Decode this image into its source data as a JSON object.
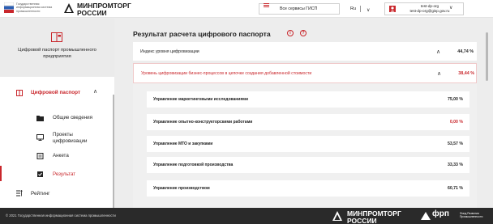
{
  "header": {
    "gisp_caption": "Государственная информационная система промышленности",
    "ministry_line1": "МИНПРОМТОРГ",
    "ministry_line2": "РОССИИ",
    "services_button": "Все сервисы ГИСП",
    "language": "Ru",
    "user_line1": "test-dp-org",
    "user_line2": "test-dp-org@gisp.gov.ru"
  },
  "sidebar": {
    "hero_title": "Цифровой паспорт промышленного предприятия",
    "digital_passport": "Цифровой паспорт",
    "submenu": {
      "general": "Общие сведения",
      "projects": "Проекты цифровизации",
      "questionnaire": "Анкета",
      "result": "Результат"
    },
    "rating": "Рейтинг"
  },
  "main": {
    "title": "Результат расчета цифрового паспорта",
    "index_panel": {
      "label": "Индекс уровня цифровизации",
      "value": "44,74 %"
    },
    "business_panel": {
      "label": "Уровень цифровизации бизнес-процессов в цепочке создания добавленной стоимости",
      "value": "38,44 %"
    },
    "rows": [
      {
        "label": "Управление маркетинговыми исследованиями",
        "value": "75,00 %"
      },
      {
        "label": "Управление опытно-конструкторскими работами",
        "value": "0,00 %"
      },
      {
        "label": "Управление МТО и закупками",
        "value": "53,57 %"
      },
      {
        "label": "Управление подготовкой производства",
        "value": "33,33 %"
      },
      {
        "label": "Управление производством",
        "value": "60,71 %"
      }
    ]
  },
  "footer": {
    "copyright": "© 2021 Государственная информационная система промышленности",
    "ministry_line1": "МИНПРОМТОРГ",
    "ministry_line2": "РОССИИ",
    "frp": "фрп",
    "frp_caption": "Фонд Развития Промышленности"
  },
  "colors": {
    "accent": "#c9272c",
    "footer_bg": "#2a2a2a",
    "page_bg": "#ededed"
  }
}
